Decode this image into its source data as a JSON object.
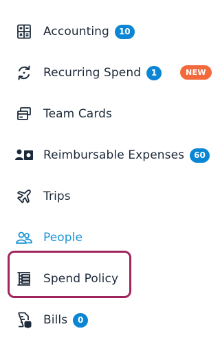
{
  "nav": {
    "items": [
      {
        "label": "Accounting",
        "badge": "10",
        "icon": "calculator-icon"
      },
      {
        "label": "Recurring Spend",
        "badge": "1",
        "tag": "NEW",
        "icon": "recurring-icon"
      },
      {
        "label": "Team Cards",
        "icon": "cards-icon"
      },
      {
        "label": "Reimbursable Expenses",
        "badge": "60",
        "icon": "reimbursement-icon"
      },
      {
        "label": "Trips",
        "icon": "plane-icon"
      },
      {
        "label": "People",
        "icon": "people-icon",
        "active": true
      },
      {
        "label": "Spend Policy",
        "icon": "policy-icon",
        "highlighted": true
      },
      {
        "label": "Bills",
        "badge": "0",
        "icon": "bill-icon"
      }
    ]
  },
  "colors": {
    "text": "#1d2a3a",
    "active": "#1a94d8",
    "badge": "#0b86d4",
    "new_tag": "#f26a3c",
    "highlight_border": "#a0245e"
  }
}
